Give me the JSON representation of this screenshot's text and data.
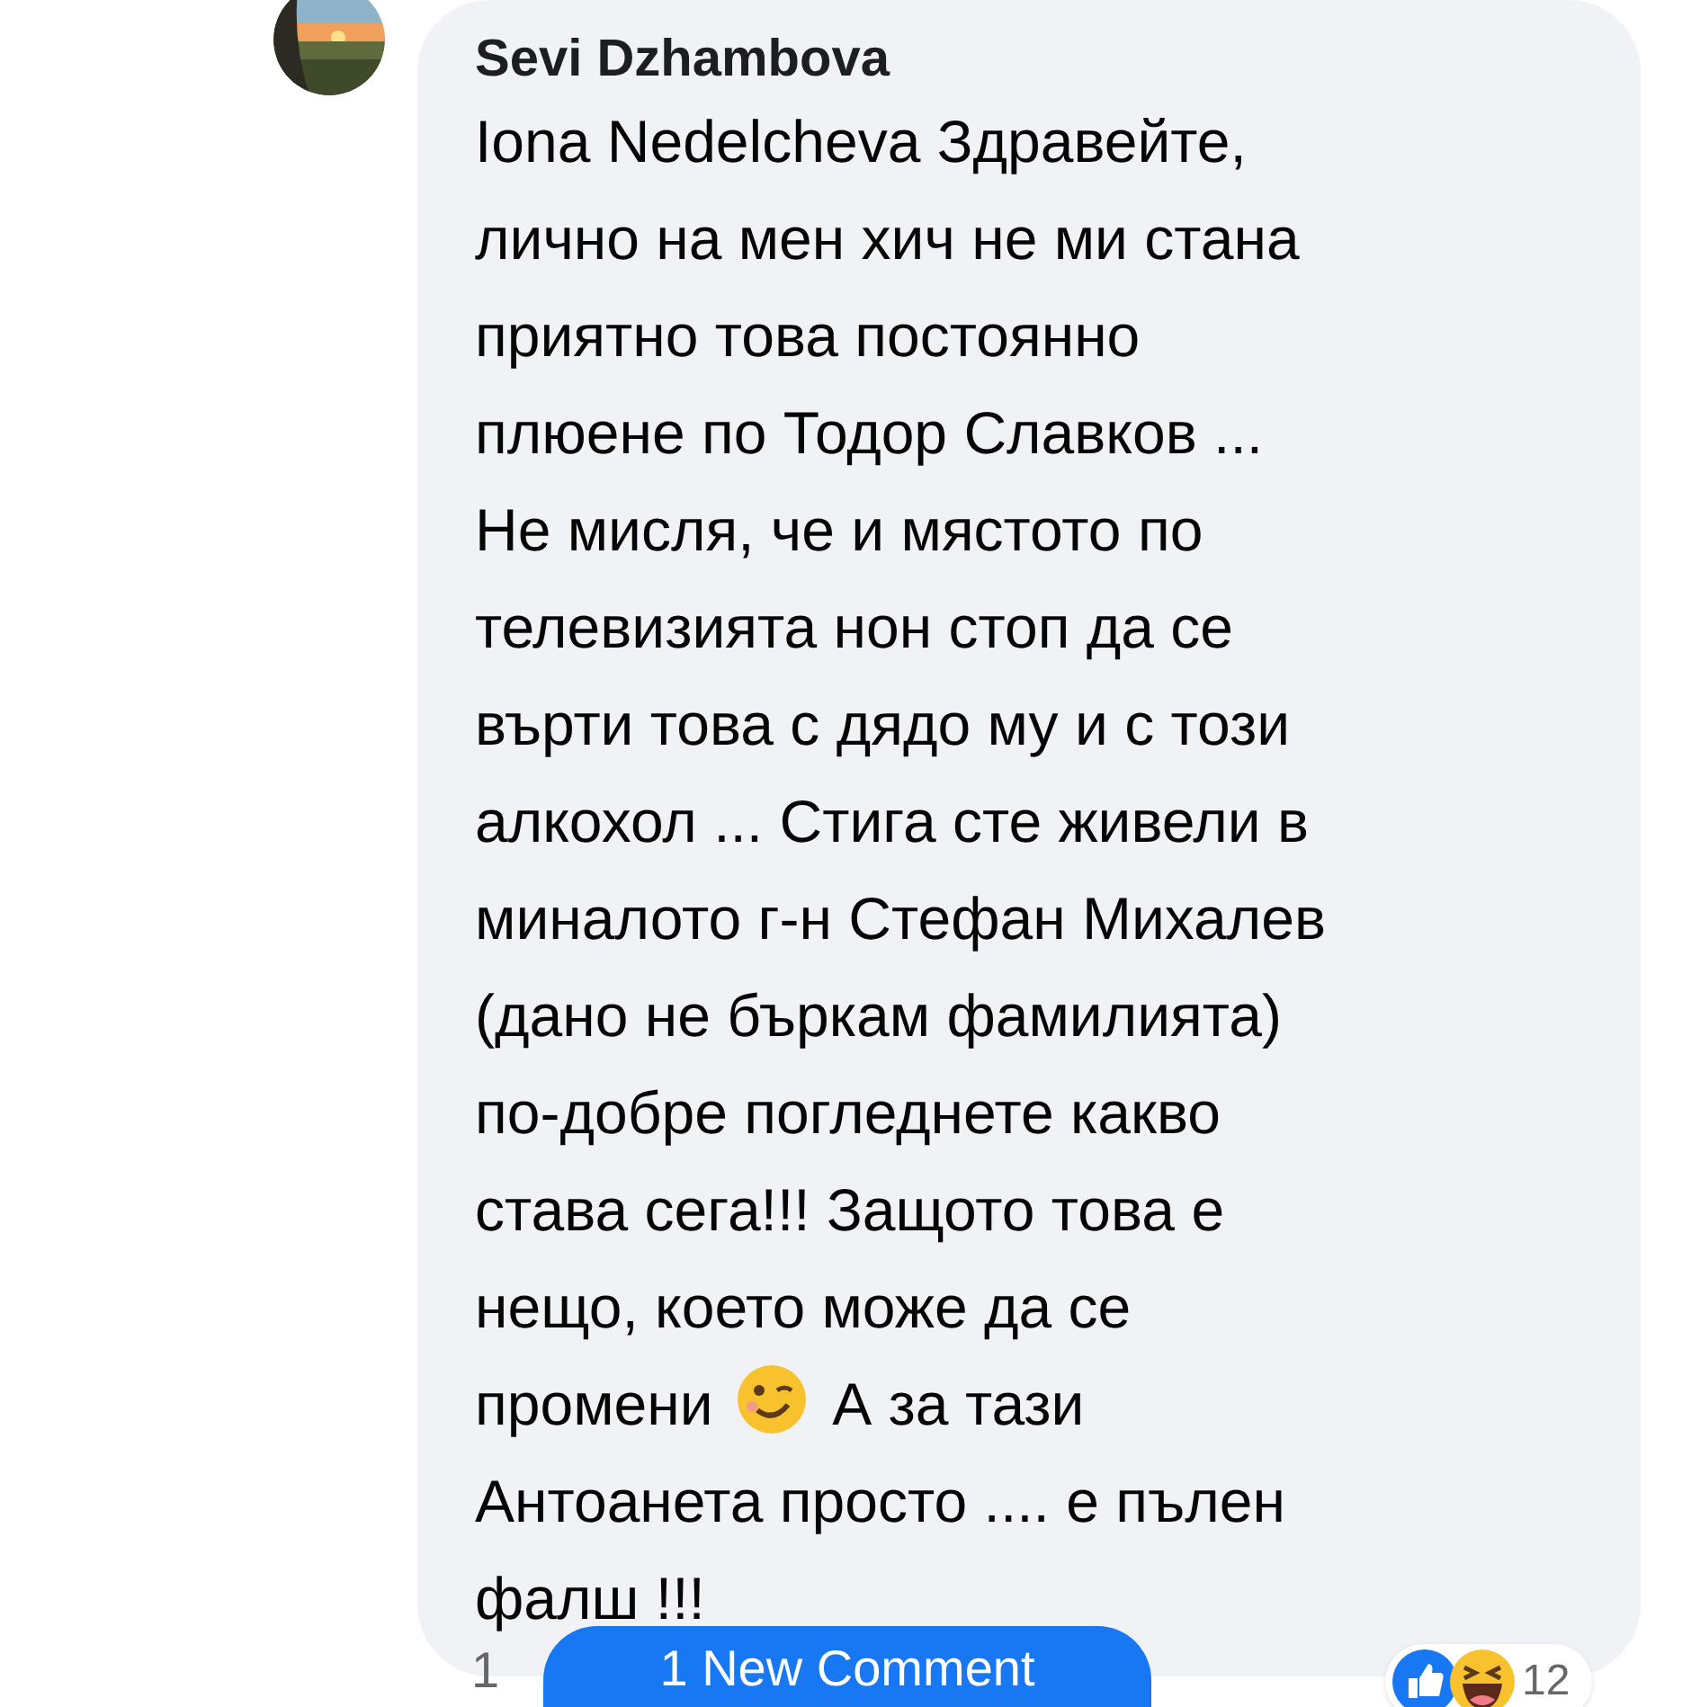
{
  "comment": {
    "author": "Sevi Dzhambova",
    "lines": [
      [
        {
          "kind": "text",
          "text": "Iona Nedelcheva  Здравейте,"
        }
      ],
      [
        {
          "kind": "text",
          "text": "лично на мен хич не ми стана"
        }
      ],
      [
        {
          "kind": "text",
          "text": "приятно това постоянно"
        }
      ],
      [
        {
          "kind": "text",
          "text": "плюене по Тодор Славков ..."
        }
      ],
      [
        {
          "kind": "text",
          "text": "Не мисля, че и мястото по"
        }
      ],
      [
        {
          "kind": "text",
          "text": "телевизията нон стоп да се"
        }
      ],
      [
        {
          "kind": "text",
          "text": "върти това с дядо му и с този"
        }
      ],
      [
        {
          "kind": "text",
          "text": "алкохол ... Стига сте живели в"
        }
      ],
      [
        {
          "kind": "text",
          "text": "миналото г-н Стефан Михалев"
        }
      ],
      [
        {
          "kind": "text",
          "text": "(дано не бъркам фамилията)"
        }
      ],
      [
        {
          "kind": "text",
          "text": "по-добре погледнете какво"
        }
      ],
      [
        {
          "kind": "text",
          "text": "става сега!!! Защото това е"
        }
      ],
      [
        {
          "kind": "text",
          "text": "нещо, което може да се"
        }
      ],
      [
        {
          "kind": "text",
          "text": "промени "
        },
        {
          "kind": "emoji"
        },
        {
          "kind": "text",
          "text": " А за тази"
        }
      ],
      [
        {
          "kind": "text",
          "text": "Антоанета просто .... е пълен"
        }
      ],
      [
        {
          "kind": "text",
          "text": "фалш !!!"
        }
      ]
    ],
    "reactions": {
      "count": "12"
    },
    "timestamp": "1"
  },
  "new_comment_button": "1 New Comment"
}
